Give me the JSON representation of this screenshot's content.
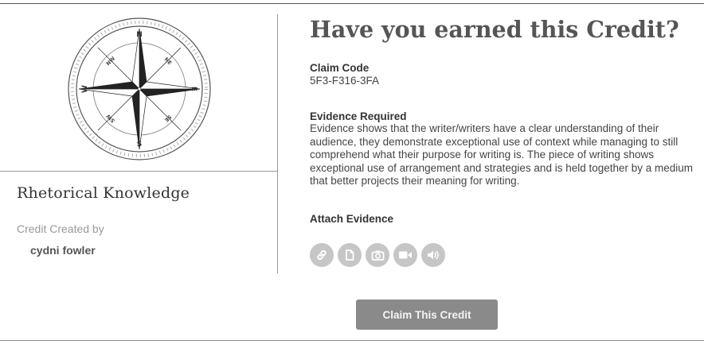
{
  "card": {
    "title": "Rhetorical Knowledge",
    "created_by_label": "Credit Created by",
    "creator": "cydni fowler",
    "image": {
      "icon": "compass-rose-icon",
      "cardinal_labels": [
        "N",
        "E",
        "S",
        "W"
      ],
      "intercardinal_labels": [
        "NE",
        "SE",
        "SW",
        "NW"
      ]
    }
  },
  "claim": {
    "heading": "Have you earned this Credit?",
    "code_label": "Claim Code",
    "code_value": "5F3-F316-3FA",
    "evidence_label": "Evidence Required",
    "evidence_text": "Evidence shows that the writer/writers have a clear understanding of their audience, they demonstrate exceptional use of context while managing to still comprehend what their purpose for writing is. The piece of writing shows exceptional use of arrangement and strategies and is held together by a medium that better projects their meaning for writing.",
    "attach_label": "Attach Evidence",
    "attach_options": [
      "link-icon",
      "document-icon",
      "camera-icon",
      "video-icon",
      "audio-icon"
    ],
    "button_label": "Claim This Credit"
  },
  "colors": {
    "button_bg": "#8a8a8a",
    "attach_icon_bg": "#c6c6c6",
    "heading": "#555555"
  }
}
